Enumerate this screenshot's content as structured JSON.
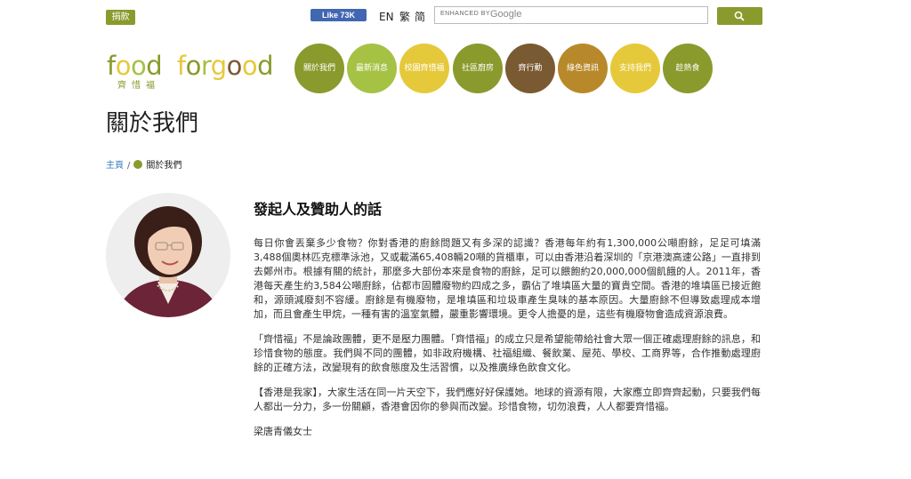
{
  "topbar": {
    "donate_label": "捐款",
    "fb_like_label": "Like 73K",
    "languages": [
      "EN",
      "繁",
      "简"
    ],
    "search_placeholder": "ENHANCED BY",
    "search_google": "Google"
  },
  "logo": {
    "text": "food forgood",
    "subtitle": "齊惜福"
  },
  "nav": [
    {
      "label": "關於我們",
      "color": "#8a9a2c"
    },
    {
      "label": "最新消息",
      "color": "#a5c245"
    },
    {
      "label": "校園齊惜福",
      "color": "#e6c93a"
    },
    {
      "label": "社區廚房",
      "color": "#8a9a2c"
    },
    {
      "label": "齊行動",
      "color": "#7a5a32"
    },
    {
      "label": "綠色資訊",
      "color": "#b8892a"
    },
    {
      "label": "支持我們",
      "color": "#e6c93a"
    },
    {
      "label": "趁熱食",
      "color": "#8a9a2c"
    }
  ],
  "page_title": "關於我們",
  "breadcrumb": {
    "home": "主頁",
    "separator": "/",
    "current": "關於我們"
  },
  "article": {
    "heading": "發起人及贊助人的話",
    "paragraphs": [
      "每日你會丟棄多少食物？你對香港的廚餘問題又有多深的認識？香港每年約有1,300,000公噸廚餘，足足可填滿3,488個奧林匹克標準泳池，又或載滿65,408輛20噸的貨櫃車，可以由香港沿着深圳的「京港澳高速公路」一直排到去鄭州市。根據有關的統計，那麼多大部份本來是食物的廚餘，足可以餵飽約20,000,000個飢餓的人。2011年，香港每天產生約3,584公噸廚餘，佔都市固體廢物約四成之多，霸佔了堆填區大量的寶貴空間。香港的堆填區已接近飽和，源頭減廢刻不容緩。廚餘是有機廢物，是堆填區和垃圾車產生臭味的基本原因。大量廚餘不但導致處理成本增加，而且會產生甲烷，一種有害的溫室氣體，嚴重影響環境。更令人擔憂的是，這些有機廢物會造成資源浪費。",
      "「齊惜福」不是論政團體，更不是壓力團體。「齊惜福」的成立只是希望能帶給社會大眾一個正確處理廚餘的訊息，和珍惜食物的態度。我們與不同的團體，如非政府機構、社福組織、餐飲業、屋苑、學校、工商界等，合作推動處理廚餘的正確方法，改變現有的飲食態度及生活習慣，以及推廣綠色飲食文化。",
      "【香港是我家】，大家生活在同一片天空下，我們應好好保護她。地球的資源有限，大家應立即齊齊起動，只要我們每人都出一分力，多一份關顧，香港會因你的參與而改變。珍惜食物，切勿浪費，人人都要齊惜福。"
    ],
    "signature": "梁唐青儀女士"
  }
}
